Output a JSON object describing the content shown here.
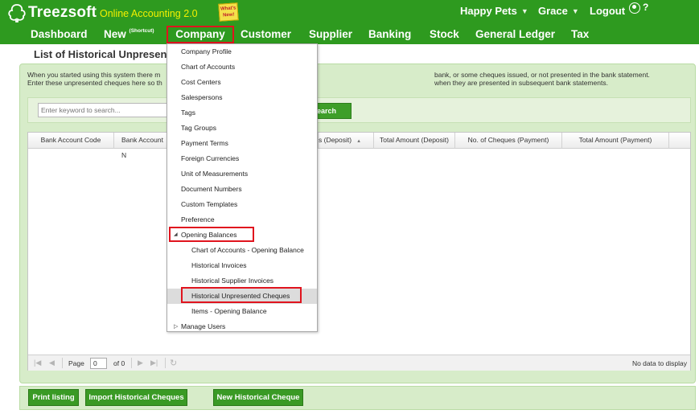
{
  "brand": {
    "name": "Treezsoft",
    "subtitle": "Online Accounting 2.0",
    "whats_new": "What's New!"
  },
  "topbar": {
    "company": "Happy Pets",
    "user": "Grace",
    "logout": "Logout",
    "help": "?"
  },
  "nav": {
    "dashboard": "Dashboard",
    "new": "New",
    "new_shortcut": "(Shortcut)",
    "company": "Company",
    "customer": "Customer",
    "supplier": "Supplier",
    "banking": "Banking",
    "stock": "Stock",
    "general_ledger": "General Ledger",
    "tax": "Tax"
  },
  "page": {
    "title": "List of Historical Unpresented Cheques",
    "visible_title": "List of Historical Unpresen",
    "desc_line1_left": "When you started using this system there m",
    "desc_line2_left": "Enter these unpresented cheques here so th",
    "desc_line1_right": "bank, or some cheques issued, or not presented in the bank statement.",
    "desc_line2_right": "when they are presented in subsequent bank statements."
  },
  "search": {
    "placeholder": "Enter keyword to search...",
    "button": "Search",
    "button_visible": "earch"
  },
  "grid": {
    "columns": [
      "Bank Account Code",
      "Bank Account N",
      "s (Deposit)",
      "Total Amount (Deposit)",
      "No. of Cheques (Payment)",
      "Total Amount (Payment)"
    ],
    "pager": {
      "page_label": "Page",
      "page_value": "0",
      "of_label": "of 0",
      "empty": "No data to display"
    }
  },
  "buttons": {
    "print": "Print listing",
    "import": "Import Historical Cheques",
    "new_cheque": "New Historical Cheque"
  },
  "company_menu": {
    "items": [
      "Company Profile",
      "Chart of Accounts",
      "Cost Centers",
      "Salespersons",
      "Tags",
      "Tag Groups",
      "Payment Terms",
      "Foreign Currencies",
      "Unit of Measurements",
      "Document Numbers",
      "Custom Templates",
      "Preference"
    ],
    "opening_balances": "Opening Balances",
    "sub_items": [
      "Chart of Accounts - Opening Balance",
      "Historical Invoices",
      "Historical Supplier Invoices",
      "Historical Unpresented Cheques",
      "Items - Opening Balance"
    ],
    "manage_users": "Manage Users",
    "selected": "Historical Unpresented Cheques"
  },
  "colors": {
    "header_green": "#2e9a1f",
    "panel_green": "#d7ecc9",
    "highlight_red": "#e0141e",
    "subtitle_yellow": "#f3f000"
  }
}
